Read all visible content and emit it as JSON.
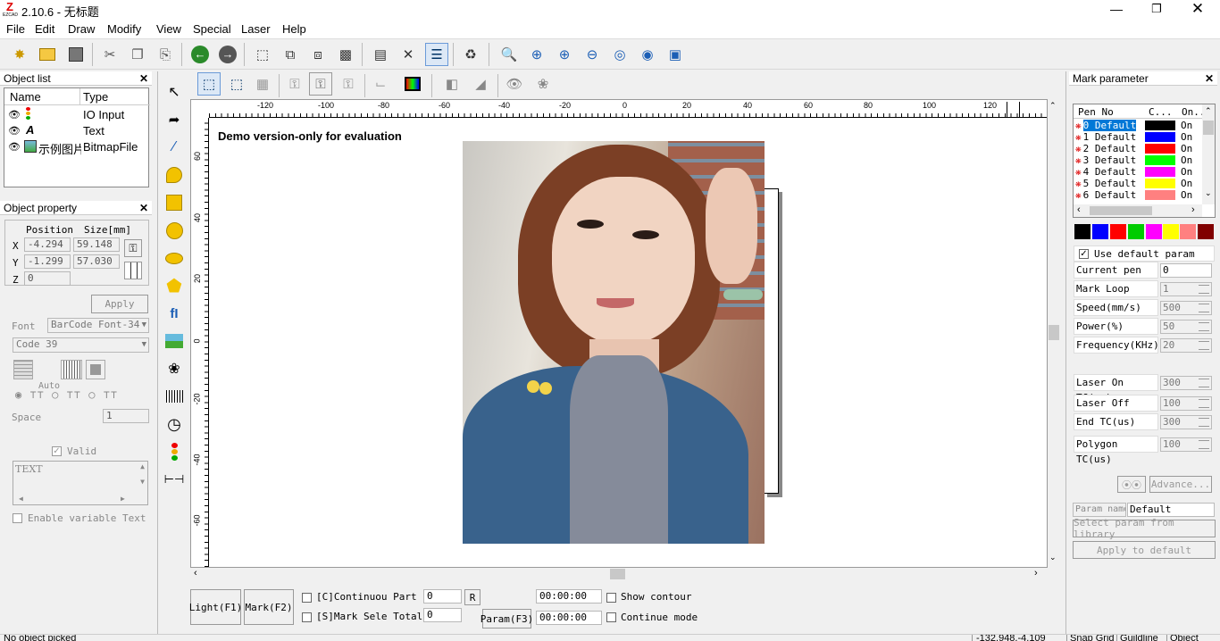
{
  "window": {
    "title": "2.10.6 - 无标题",
    "app_icon_text": "EZCAD"
  },
  "menu": [
    "File",
    "Edit",
    "Draw",
    "Modify",
    "View",
    "Special",
    "Laser",
    "Help"
  ],
  "object_list": {
    "title": "Object list",
    "columns": [
      "Name",
      "Type"
    ],
    "rows": [
      {
        "name": "",
        "type": "IO Input"
      },
      {
        "name": "A",
        "type": "Text"
      },
      {
        "name": "示例图片",
        "type": "BitmapFile"
      }
    ]
  },
  "object_property": {
    "title": "Object property",
    "position_label": "Position",
    "size_label": "Size[mm]",
    "x_label": "X",
    "y_label": "Y",
    "z_label": "Z",
    "x": "-4.294",
    "y": "-1.299",
    "z": "0",
    "width": "59.148",
    "height": "57.030",
    "apply": "Apply",
    "font_label": "Font",
    "font_value": "BarCode Font-34",
    "code_value": "Code 39",
    "auto_label": "Auto",
    "space_label": "Space",
    "space_value": "1",
    "valid_label": "Valid",
    "text_value": "TEXT",
    "enable_var_label": "Enable variable Text"
  },
  "canvas": {
    "demo_text": "Demo version-only for evaluation",
    "ruler_top": [
      "-120",
      "-100",
      "-80",
      "-60",
      "-40",
      "-20",
      "0",
      "20",
      "40",
      "60",
      "80",
      "100",
      "120"
    ],
    "ruler_left": [
      "60",
      "40",
      "20",
      "0",
      "-20",
      "-40",
      "-60"
    ]
  },
  "bottom": {
    "light": "Light(F1)",
    "mark": "Mark(F2)",
    "continuous_label": "[C]Continuou Part",
    "mark_sel_label": "[S]Mark Sele Total",
    "part_value": "0",
    "total_value": "0",
    "r_button": "R",
    "time1": "00:00:00",
    "time2": "00:00:00",
    "param_button": "Param(F3)",
    "show_contour": "Show contour",
    "continue_mode": "Continue mode"
  },
  "status": {
    "left": "No object picked",
    "coords": "-132.948,-4.109",
    "snap1": "Snap Grid",
    "snap2": "Guildline",
    "snap3": "Object Snap"
  },
  "mark_parameter": {
    "title": "Mark parameter",
    "columns": [
      "Pen No",
      "C...",
      "On..."
    ],
    "pens": [
      {
        "label": "0 Default",
        "color": "#000000",
        "on": "On"
      },
      {
        "label": "1 Default",
        "color": "#0000ff",
        "on": "On"
      },
      {
        "label": "2 Default",
        "color": "#ff0000",
        "on": "On"
      },
      {
        "label": "3 Default",
        "color": "#00ff00",
        "on": "On"
      },
      {
        "label": "4 Default",
        "color": "#ff00ff",
        "on": "On"
      },
      {
        "label": "5 Default",
        "color": "#ffff00",
        "on": "On"
      },
      {
        "label": "6 Default",
        "color": "#ff8080",
        "on": "On"
      }
    ],
    "swatches": [
      "#000000",
      "#0000ff",
      "#ff0000",
      "#00cc00",
      "#ff00ff",
      "#ffff00",
      "#ff8080",
      "#800000"
    ],
    "use_default": "Use default param",
    "params": [
      {
        "label": "Current pen",
        "value": "0"
      },
      {
        "label": "Mark Loop",
        "value": "1"
      },
      {
        "label": "Speed(mm/s)",
        "value": "500"
      },
      {
        "label": "Power(%)",
        "value": "50"
      },
      {
        "label": "Frequency(KHz)",
        "value": "20"
      },
      {
        "label": "Laser On TC(us)",
        "value": "300"
      },
      {
        "label": "Laser Off TC(us",
        "value": "100"
      },
      {
        "label": "End TC(us)",
        "value": "300"
      },
      {
        "label": "Polygon TC(us)",
        "value": "100"
      }
    ],
    "advance": "Advance...",
    "param_name_label": "Param name",
    "param_name_value": "Default",
    "select_library": "Select param from library",
    "apply_default": "Apply to default"
  }
}
